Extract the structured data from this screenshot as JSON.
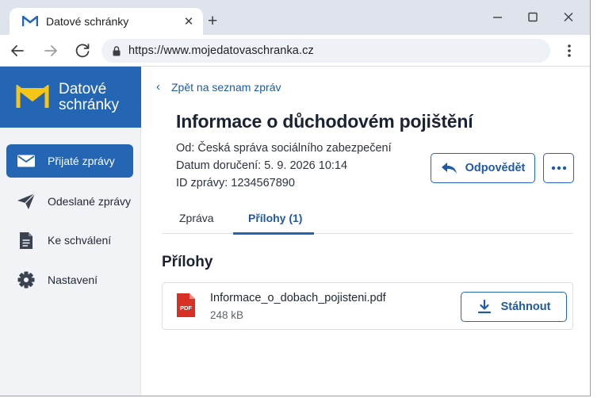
{
  "browser": {
    "tab_title": "Datové schránky",
    "url": "https://www.mojedatovaschranka.cz",
    "icons": [
      "favicon-logo",
      "close-icon",
      "plus-icon",
      "minimize-icon",
      "maximize-icon",
      "close-window-icon",
      "back-arrow-icon",
      "forward-arrow-icon",
      "reload-icon",
      "lock-icon",
      "kebab-menu-icon"
    ]
  },
  "brand": {
    "line1": "Datové",
    "line2": "schránky",
    "accent": "#2466b4",
    "logo_color": "#f5c518"
  },
  "sidebar": {
    "items": [
      {
        "label": "Přijaté zprávy",
        "icon": "envelope-icon",
        "active": true
      },
      {
        "label": "Odeslané zprávy",
        "icon": "paper-plane-icon",
        "active": false
      },
      {
        "label": "Ke schválení",
        "icon": "document-icon",
        "active": false
      },
      {
        "label": "Nastavení",
        "icon": "gear-icon",
        "active": false
      }
    ]
  },
  "message": {
    "back_label": "Zpět na seznam zpráv",
    "title": "Informace o důchodovém pojištění",
    "from": "Od: Česká správa sociálního zabezpečení",
    "delivered": "Datum doručení: 5. 9. 2026 10:14",
    "id": "ID zprávy:  1234567890",
    "reply_label": "Odpovědět"
  },
  "tabs": [
    {
      "label": "Zpráva",
      "active": false
    },
    {
      "label": "Přílohy (1)",
      "active": true
    }
  ],
  "attachments": {
    "heading": "Přílohy",
    "items": [
      {
        "file_name": "Informace_o_dobach_pojisteni.pdf",
        "size": "248 kB",
        "badge": "PDF",
        "download_label": "Stáhnout"
      }
    ]
  }
}
